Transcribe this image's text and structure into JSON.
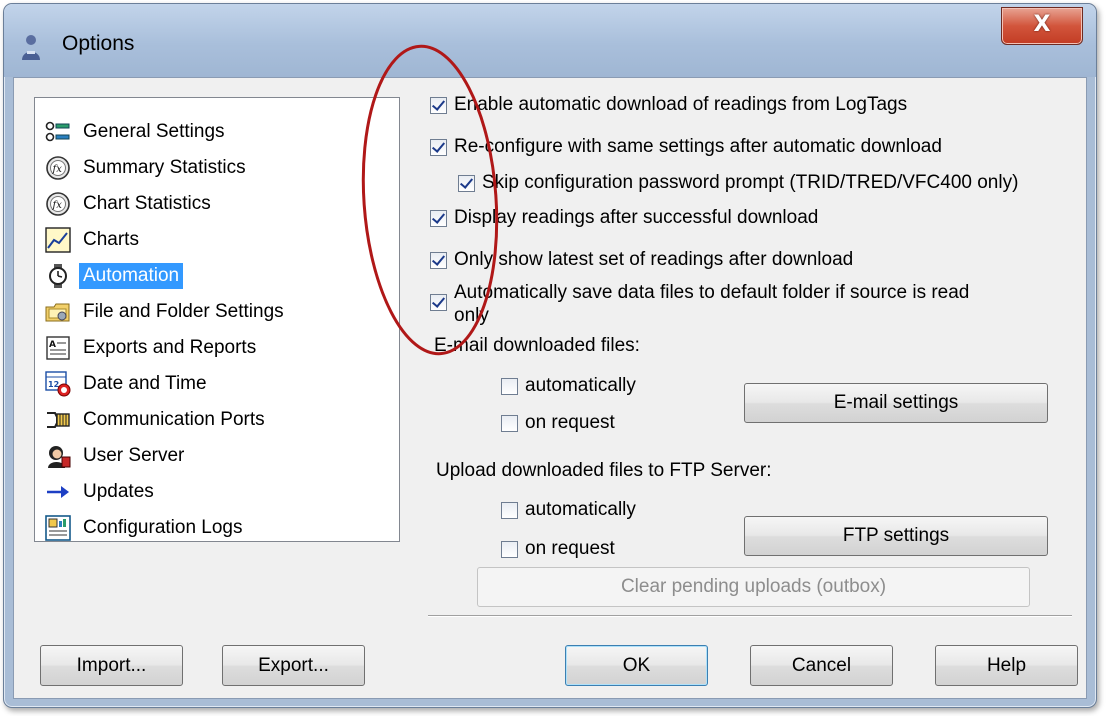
{
  "window": {
    "title": "Options",
    "close_symbol": "X"
  },
  "nav": {
    "items": [
      {
        "label": "General Settings",
        "icon": "general-settings-icon"
      },
      {
        "label": "Summary Statistics",
        "icon": "summary-statistics-icon"
      },
      {
        "label": "Chart Statistics",
        "icon": "chart-statistics-icon"
      },
      {
        "label": "Charts",
        "icon": "charts-icon"
      },
      {
        "label": "Automation",
        "icon": "automation-icon",
        "selected": true
      },
      {
        "label": "File and Folder Settings",
        "icon": "folder-settings-icon"
      },
      {
        "label": "Exports and Reports",
        "icon": "exports-reports-icon"
      },
      {
        "label": "Date and Time",
        "icon": "date-time-icon"
      },
      {
        "label": "Communication Ports",
        "icon": "communication-ports-icon"
      },
      {
        "label": "User Server",
        "icon": "user-server-icon"
      },
      {
        "label": "Updates",
        "icon": "updates-arrow-icon"
      },
      {
        "label": "Configuration Logs",
        "icon": "configuration-logs-icon"
      }
    ]
  },
  "automation": {
    "options": [
      {
        "label": "Enable automatic download of readings from LogTags",
        "checked": true
      },
      {
        "label": "Re-configure with same settings after automatic download",
        "checked": true
      },
      {
        "label": "Skip configuration password prompt (TRID/TRED/VFC400 only)",
        "checked": true
      },
      {
        "label": "Display readings after successful download",
        "checked": true
      },
      {
        "label": "Only show latest set of readings after download",
        "checked": true
      },
      {
        "label_line1": "Automatically save data files to default folder if source is read",
        "label_line2": "only",
        "checked": true
      }
    ],
    "email": {
      "heading": "E-mail downloaded files:",
      "automatically": "automatically",
      "on_request": "on request",
      "settings_button": "E-mail settings"
    },
    "ftp": {
      "heading": "Upload downloaded files to FTP Server:",
      "automatically": "automatically",
      "on_request": "on request",
      "settings_button": "FTP settings",
      "clear_button": "Clear pending uploads (outbox)"
    }
  },
  "footer": {
    "import": "Import...",
    "export": "Export...",
    "ok": "OK",
    "cancel": "Cancel",
    "help": "Help"
  },
  "colors": {
    "selection": "#3399ff",
    "annotation": "#b01818",
    "close_button": "#c94a35"
  }
}
